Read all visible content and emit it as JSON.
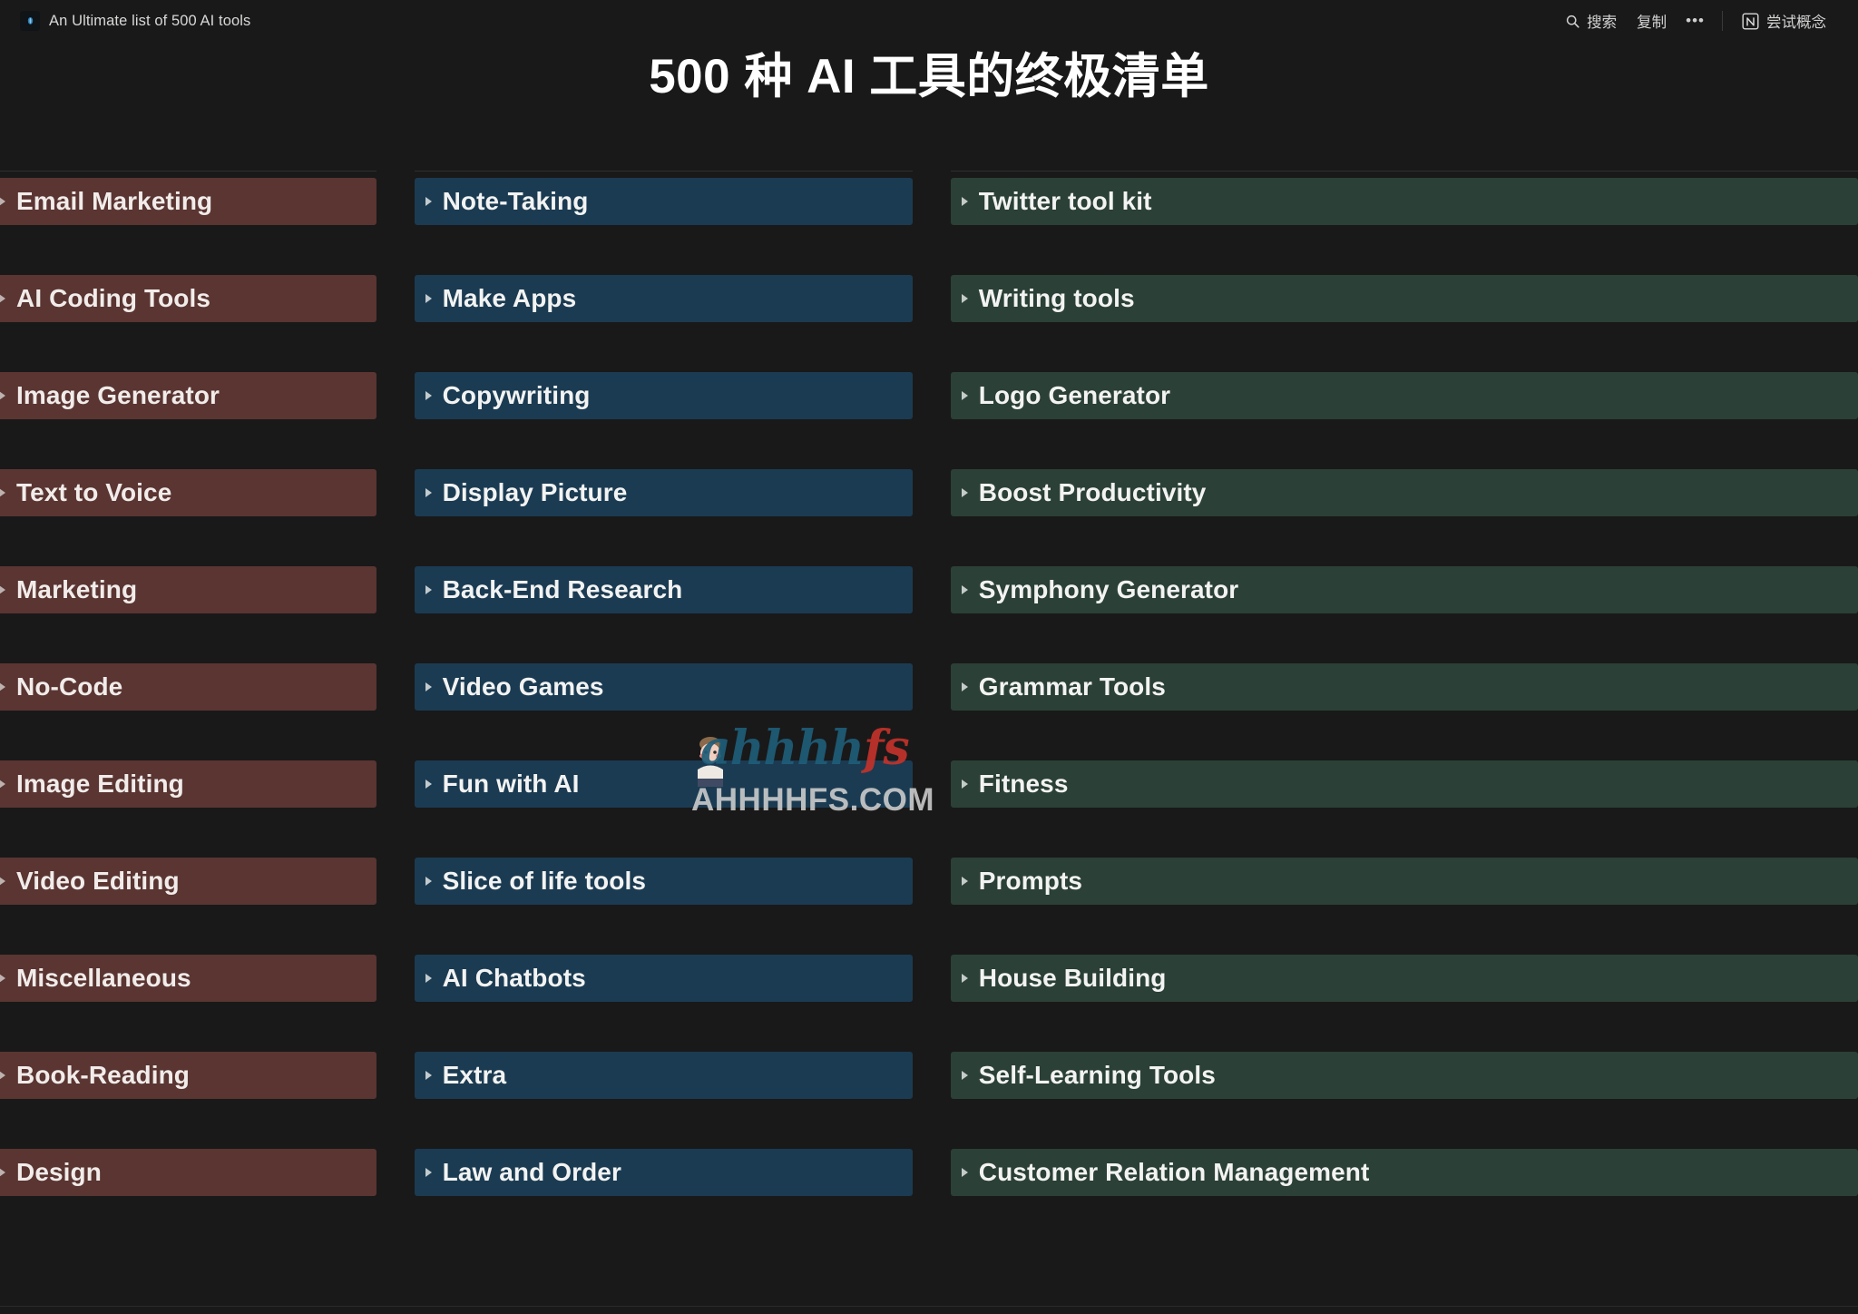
{
  "topbar": {
    "page_icon": "document-icon",
    "breadcrumb_title": "An Ultimate list of 500 AI tools",
    "search_icon": "search-icon",
    "search_label": "搜索",
    "duplicate_label": "复制",
    "more_label": "•••",
    "notion_icon": "notion-logo-icon",
    "try_notion_label": "尝试概念"
  },
  "hero": {
    "title": "500 种 AI 工具的终极清单"
  },
  "colors": {
    "page_background": "#191919",
    "column_left_accent": "#5a3532",
    "column_mid_accent": "#1b3b52",
    "column_right_accent": "#2b4036",
    "toggle_text": "#f1ecea",
    "divider": "#2f2f2e"
  },
  "columns": [
    {
      "id": "column-left",
      "accent": "#5a3532",
      "items": [
        {
          "label": "Email Marketing"
        },
        {
          "label": "AI Coding Tools"
        },
        {
          "label": "Image Generator"
        },
        {
          "label": "Text to Voice"
        },
        {
          "label": "Marketing"
        },
        {
          "label": "No-Code"
        },
        {
          "label": "Image Editing"
        },
        {
          "label": "Video Editing"
        },
        {
          "label": "Miscellaneous"
        },
        {
          "label": "Book-Reading"
        },
        {
          "label": "Design"
        }
      ]
    },
    {
      "id": "column-middle",
      "accent": "#1b3b52",
      "items": [
        {
          "label": "Note-Taking"
        },
        {
          "label": "Make Apps"
        },
        {
          "label": "Copywriting"
        },
        {
          "label": "Display Picture"
        },
        {
          "label": "Back-End Research"
        },
        {
          "label": "Video Games"
        },
        {
          "label": "Fun with AI"
        },
        {
          "label": "Slice of life tools"
        },
        {
          "label": "AI Chatbots"
        },
        {
          "label": "Extra"
        },
        {
          "label": "Law and Order"
        }
      ]
    },
    {
      "id": "column-right",
      "accent": "#2b4036",
      "items": [
        {
          "label": "Twitter tool kit"
        },
        {
          "label": "Writing tools"
        },
        {
          "label": "Logo Generator"
        },
        {
          "label": "Boost Productivity"
        },
        {
          "label": "Symphony Generator"
        },
        {
          "label": "Grammar Tools"
        },
        {
          "label": "Fitness"
        },
        {
          "label": "Prompts"
        },
        {
          "label": "House Building"
        },
        {
          "label": "Self-Learning Tools"
        },
        {
          "label": "Customer Relation Management"
        }
      ]
    }
  ],
  "watermark": {
    "script_a": "a",
    "script_hhhh": "hhhh",
    "script_f": "f",
    "script_s": "s",
    "domain": "AHHHHFS.COM"
  }
}
